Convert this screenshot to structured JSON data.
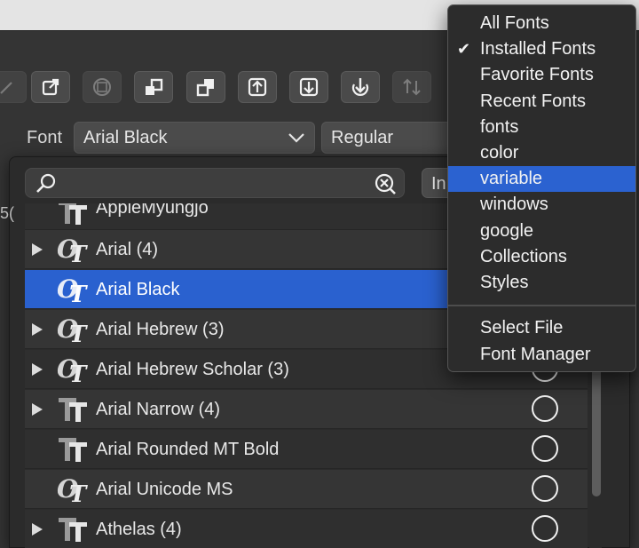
{
  "toolbar": {
    "buttons": [
      {
        "icon": "edit-icon",
        "enabled": false
      },
      {
        "icon": "open-external-icon",
        "enabled": true
      },
      {
        "icon": "grid-icon",
        "enabled": false
      },
      {
        "icon": "bring-forward-icon",
        "enabled": true
      },
      {
        "icon": "send-backward-icon",
        "enabled": true
      },
      {
        "icon": "upload-icon",
        "enabled": true
      },
      {
        "icon": "download-icon",
        "enabled": true
      },
      {
        "icon": "download-circle-icon",
        "enabled": true
      },
      {
        "icon": "swap-icon",
        "enabled": false
      }
    ]
  },
  "font_row": {
    "label": "Font",
    "family": "Arial Black",
    "style": "Regular"
  },
  "picker": {
    "search_value": "",
    "filter_label": "In",
    "fonts": [
      {
        "name": "AppleMyungjo",
        "type": "truetype",
        "expandable": false
      },
      {
        "name": "Arial (4)",
        "type": "opentype",
        "expandable": true
      },
      {
        "name": "Arial Black",
        "type": "opentype",
        "expandable": false,
        "selected": true
      },
      {
        "name": "Arial Hebrew (3)",
        "type": "opentype",
        "expandable": true
      },
      {
        "name": "Arial Hebrew Scholar (3)",
        "type": "opentype",
        "expandable": true
      },
      {
        "name": "Arial Narrow (4)",
        "type": "truetype",
        "expandable": true
      },
      {
        "name": "Arial Rounded MT Bold",
        "type": "truetype",
        "expandable": false
      },
      {
        "name": "Arial Unicode MS",
        "type": "opentype",
        "expandable": false
      },
      {
        "name": "Athelas (4)",
        "type": "truetype",
        "expandable": true
      }
    ]
  },
  "menu": {
    "checked": "Installed Fonts",
    "highlighted": "variable",
    "items": [
      "All Fonts",
      "Installed Fonts",
      "Favorite Fonts",
      "Recent Fonts",
      "fonts",
      "color",
      "variable",
      "windows",
      "google",
      "Collections",
      "Styles"
    ],
    "footer_items": [
      "Select File",
      "Font Manager"
    ]
  },
  "colors": {
    "selection": "#2a61cf",
    "menu_highlight": "#2b62d0",
    "panel": "#2b2b2b"
  }
}
